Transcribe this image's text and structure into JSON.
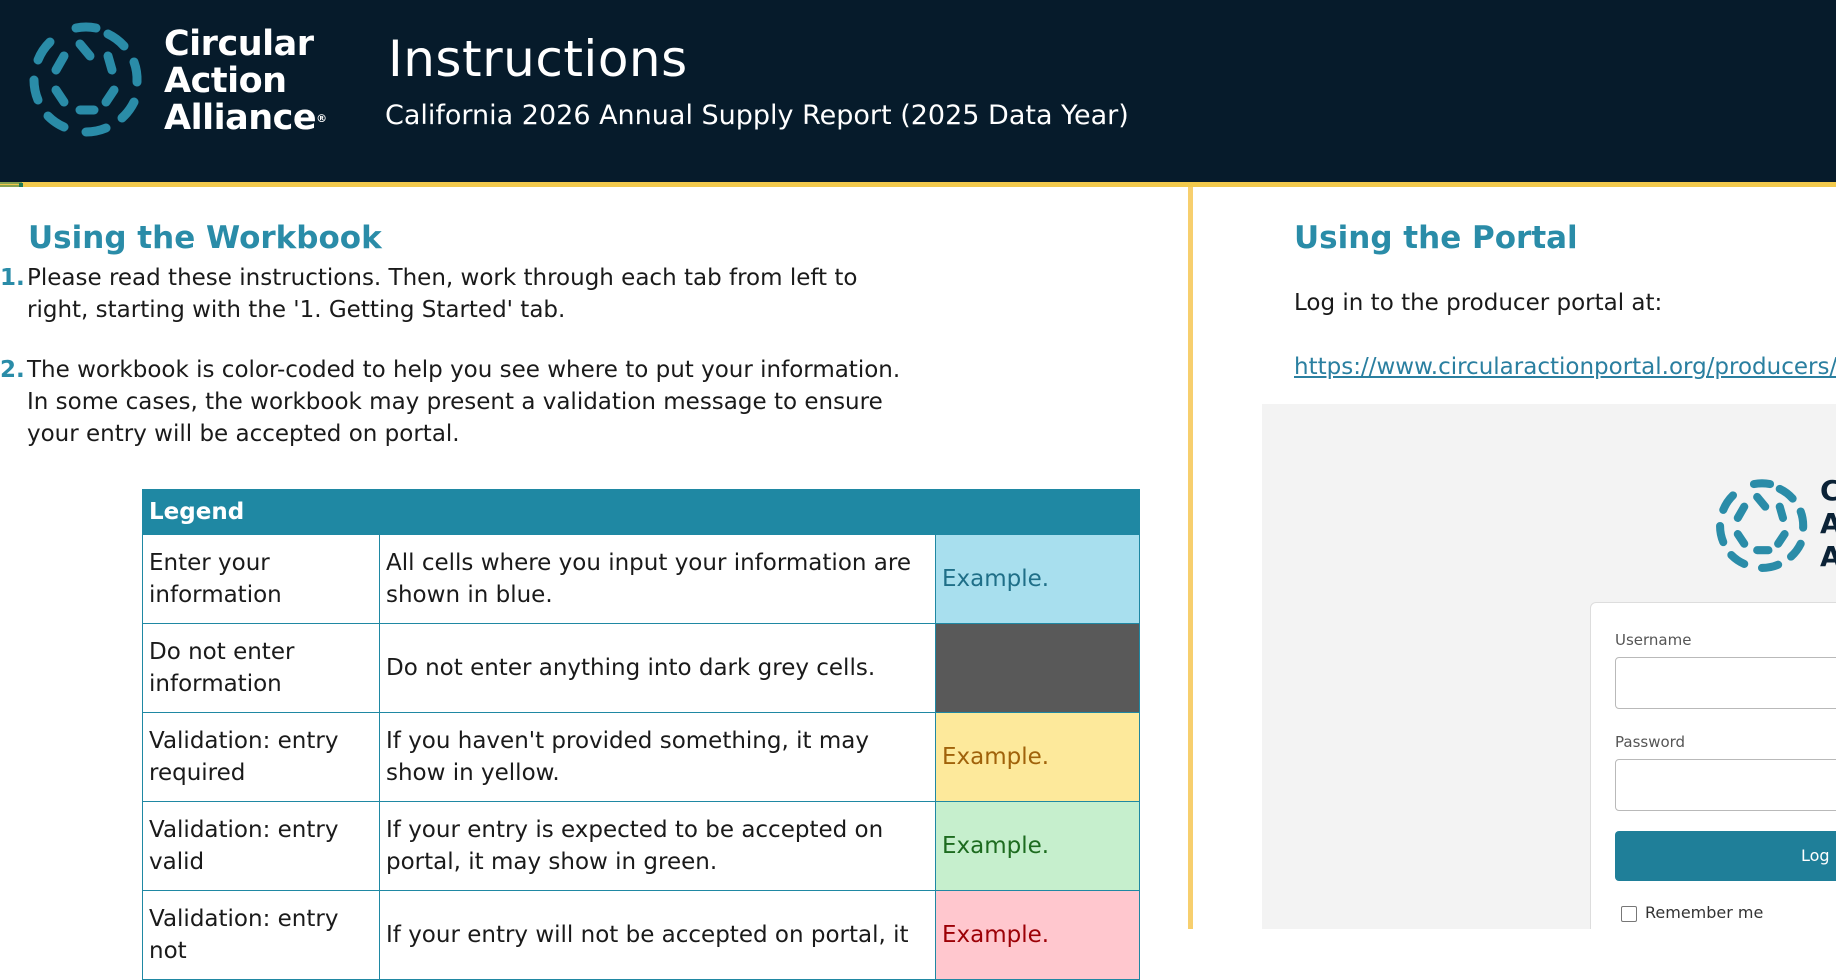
{
  "brand": {
    "logo_lines": [
      "Circular",
      "Action",
      "Alliance"
    ],
    "registered_mark": "®",
    "trademark": "™",
    "accent_color": "#2a8ca8",
    "header_bg": "#061b2b",
    "gold_rule": "#f2c94c"
  },
  "header": {
    "title": "Instructions",
    "subtitle": "California 2026 Annual Supply Report (2025 Data Year)"
  },
  "workbook": {
    "section_title": "Using the Workbook",
    "steps": [
      {
        "num": "1.",
        "text": "Please read these instructions. Then, work through each tab from left to right, starting with the '1. Getting Started' tab."
      },
      {
        "num": "2.",
        "text": "The workbook is color-coded to help you see where to put your information. In some cases, the workbook may present a validation message to ensure your entry will be accepted on portal."
      }
    ],
    "legend": {
      "header": "Legend",
      "rows": [
        {
          "label": "Enter your information",
          "description": "All cells where you input your information are shown in blue.",
          "example": "Example.",
          "swatch_bg": "#a8dfee",
          "swatch_fg": "#1f6f88"
        },
        {
          "label": "Do not enter information",
          "description": "Do not enter anything into dark grey cells.",
          "example": "",
          "swatch_bg": "#595959",
          "swatch_fg": "#595959"
        },
        {
          "label": "Validation: entry required",
          "description": "If you haven't provided something, it may show in yellow.",
          "example": "Example.",
          "swatch_bg": "#fde99b",
          "swatch_fg": "#a0620a"
        },
        {
          "label": "Validation: entry valid",
          "description": "If your entry is expected to be accepted on portal, it may show in green.",
          "example": "Example.",
          "swatch_bg": "#c6efcd",
          "swatch_fg": "#1d6b1f"
        },
        {
          "label": "Validation: entry not",
          "description": "If your entry will not be accepted on portal, it",
          "example": "Example.",
          "swatch_bg": "#ffc7ce",
          "swatch_fg": "#9c0006"
        }
      ]
    }
  },
  "portal": {
    "section_title": "Using the Portal",
    "login_text": "Log in to the producer portal at:",
    "url": "https://www.circularactionportal.org/producers/login",
    "screenshot": {
      "logo_letters": [
        "C",
        "A",
        "A"
      ],
      "username_label": "Username",
      "password_label": "Password",
      "login_button": "Log In",
      "remember_label": "Remember me"
    }
  }
}
